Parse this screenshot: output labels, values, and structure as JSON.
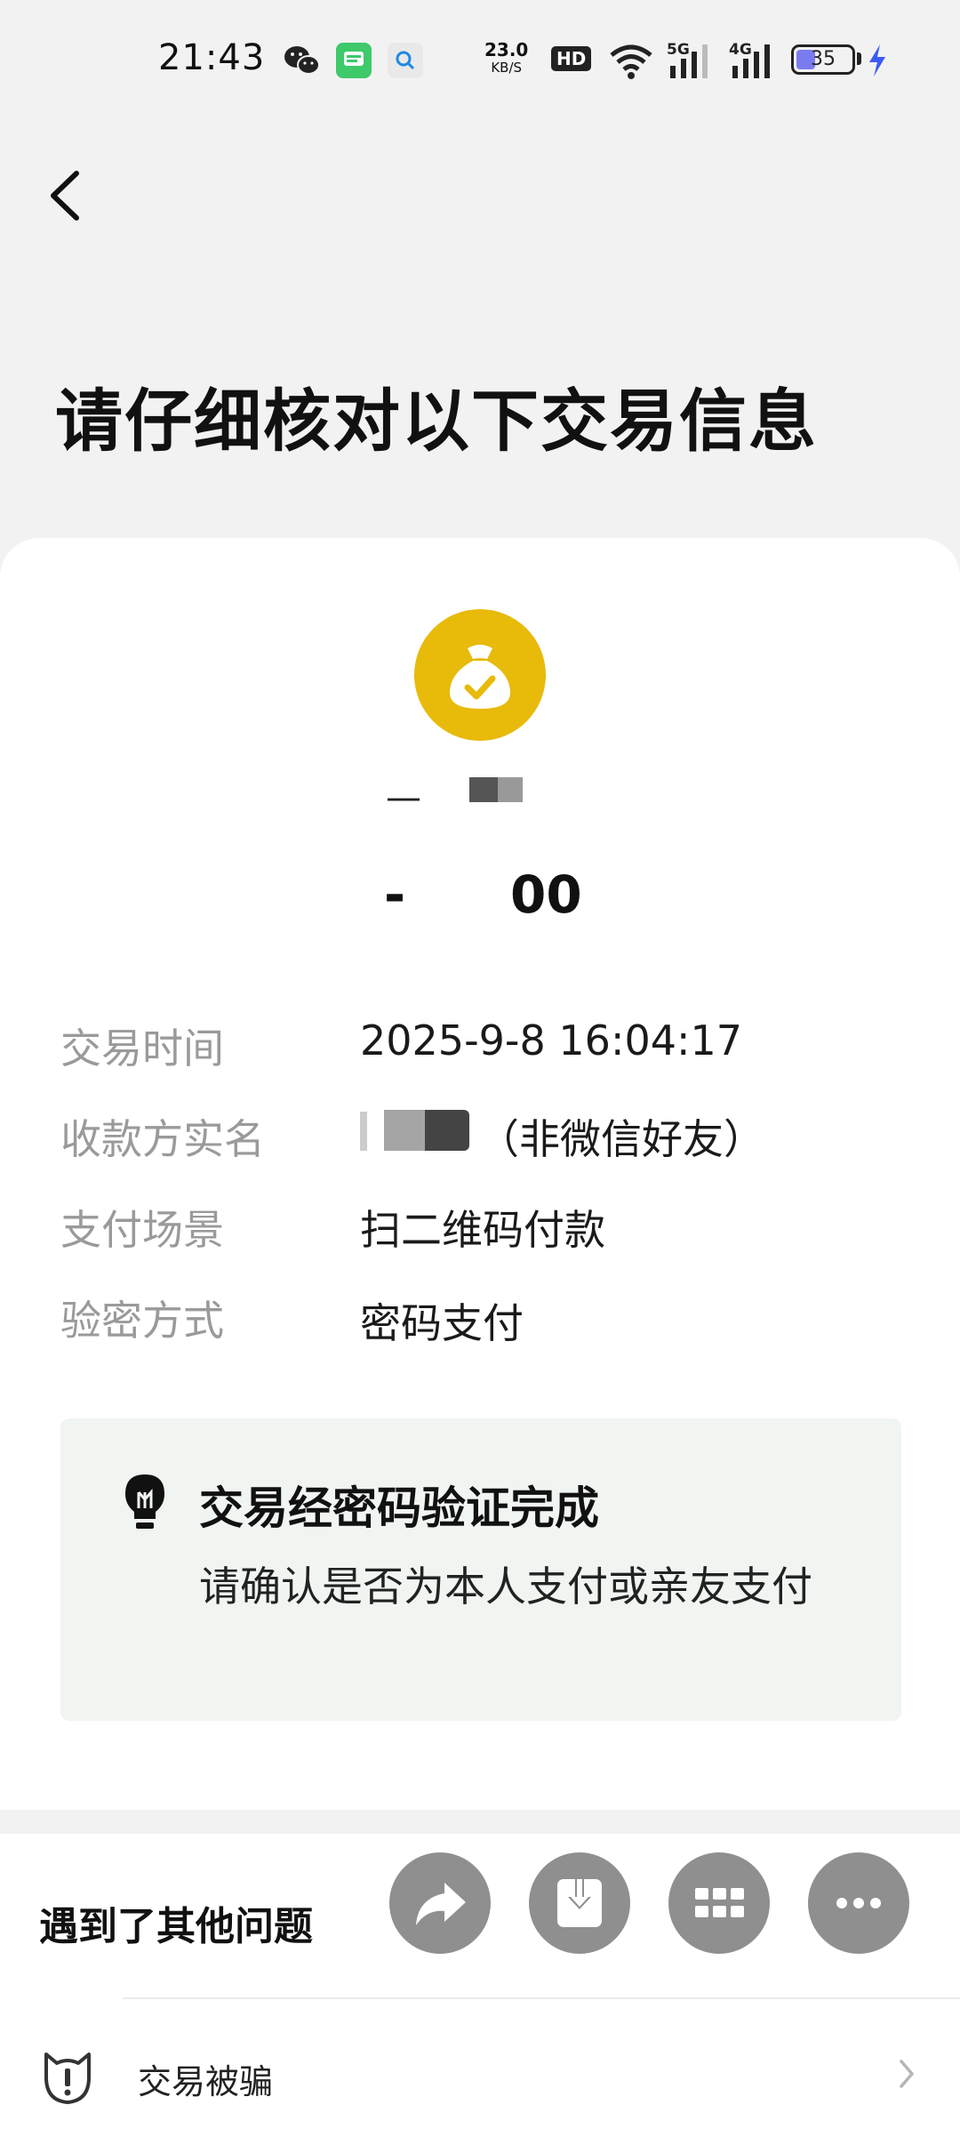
{
  "status_bar": {
    "time": "21:43",
    "net_speed_value": "23.0",
    "net_speed_unit": "KB/S",
    "hd_label": "HD",
    "signal_5g": "5G",
    "signal_4g": "4G",
    "battery_level": "35",
    "icons": [
      "wechat-icon",
      "messages-icon",
      "search-app-icon",
      "wifi-icon",
      "signal-5g-icon",
      "signal-4g-icon",
      "battery-icon",
      "charging-icon"
    ]
  },
  "header": {
    "title": "请仔细核对以下交易信息"
  },
  "transaction": {
    "payee_name_prefix": "—",
    "amount_prefix": "-",
    "amount_suffix": "00",
    "rows": [
      {
        "label": "交易时间",
        "value": "2025-9-8 16:04:17"
      },
      {
        "label": "收款方实名",
        "value": "（非微信好友）"
      },
      {
        "label": "支付场景",
        "value": "扫二维码付款"
      },
      {
        "label": "验密方式",
        "value": "密码支付"
      }
    ]
  },
  "notice": {
    "title": "交易经密码验证完成",
    "text": "请确认是否为本人支付或亲友支付"
  },
  "bottom_sheet": {
    "title": "遇到了其他问题",
    "actions": [
      "share-icon",
      "download-icon",
      "apps-grid-icon",
      "more-icon"
    ],
    "fraud_label": "交易被骗"
  },
  "colors": {
    "accent_gold": "#e8ba0a",
    "page_bg": "#f2f2f2",
    "notice_bg": "#f1f5f2",
    "action_gray": "#8f8f8f",
    "charging_blue": "#3b5bf5"
  }
}
